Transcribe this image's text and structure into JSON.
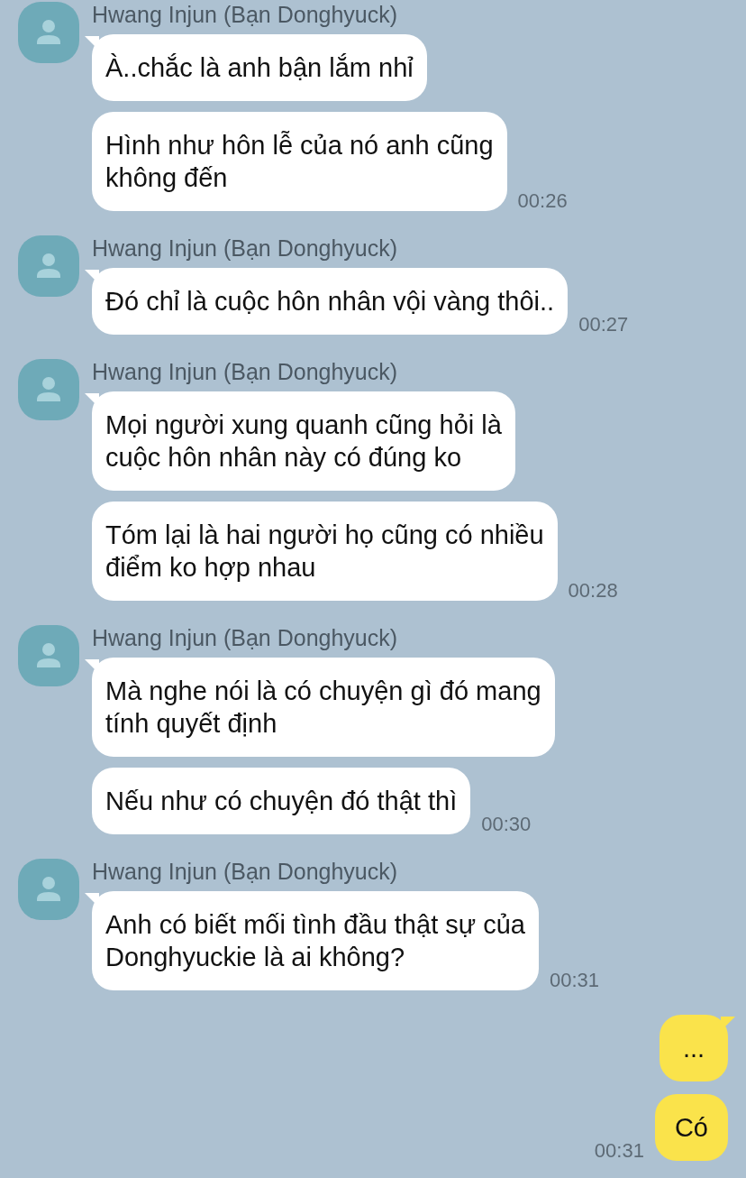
{
  "groups": [
    {
      "kind": "received",
      "sender": "Hwang Injun (Bạn Donghyuck)",
      "bubbles": [
        {
          "text": "À..chắc là anh bận lắm nhỉ"
        },
        {
          "text": "Hình như hôn lễ của nó anh cũng\nkhông đến",
          "time": "00:26"
        }
      ]
    },
    {
      "kind": "received",
      "sender": "Hwang Injun (Bạn Donghyuck)",
      "bubbles": [
        {
          "text": "Đó chỉ là cuộc hôn nhân vội vàng thôi..",
          "time": "00:27"
        }
      ]
    },
    {
      "kind": "received",
      "sender": "Hwang Injun (Bạn Donghyuck)",
      "bubbles": [
        {
          "text": "Mọi người xung quanh cũng hỏi là\ncuộc hôn nhân này có đúng ko"
        },
        {
          "text": "Tóm lại là hai người họ cũng có nhiều\nđiểm ko hợp nhau",
          "time": "00:28"
        }
      ]
    },
    {
      "kind": "received",
      "sender": "Hwang Injun (Bạn Donghyuck)",
      "bubbles": [
        {
          "text": "Mà nghe nói là có chuyện gì đó mang\ntính quyết định"
        },
        {
          "text": "Nếu như có chuyện đó thật thì",
          "time": "00:30"
        }
      ]
    },
    {
      "kind": "received",
      "sender": "Hwang Injun (Bạn Donghyuck)",
      "bubbles": [
        {
          "text": "Anh có biết mối tình đầu thật sự của\nDonghyuckie là ai không?",
          "time": "00:31"
        }
      ]
    },
    {
      "kind": "sent",
      "bubbles": [
        {
          "text": "..."
        },
        {
          "text": "Có",
          "time": "00:31"
        }
      ]
    }
  ]
}
